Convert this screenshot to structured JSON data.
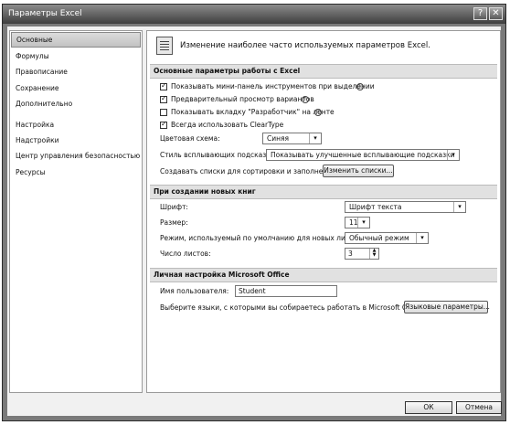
{
  "window": {
    "title": "Параметры Excel",
    "help_icon": "?",
    "close_icon": "✕"
  },
  "sidebar": {
    "items": [
      {
        "label": "Основные",
        "selected": true
      },
      {
        "label": "Формулы"
      },
      {
        "label": "Правописание"
      },
      {
        "label": "Сохранение"
      },
      {
        "label": "Дополнительно"
      },
      {
        "label": "Настройка"
      },
      {
        "label": "Надстройки"
      },
      {
        "label": "Центр управления безопасностью"
      },
      {
        "label": "Ресурсы"
      }
    ]
  },
  "header": {
    "text": "Изменение наиболее часто используемых параметров Excel."
  },
  "section1": {
    "title": "Основные параметры работы с Excel",
    "checks": [
      {
        "label": "Показывать мини-панель инструментов при выделении",
        "checked": true,
        "info": true
      },
      {
        "label": "Предварительный просмотр вариантов",
        "checked": true,
        "info": true
      },
      {
        "label": "Показывать вкладку \"Разработчик\" на ленте",
        "checked": false,
        "info": true
      },
      {
        "label": "Всегда использовать ClearType",
        "checked": true,
        "info": false
      }
    ],
    "color_scheme_label": "Цветовая схема:",
    "color_scheme_value": "Синяя",
    "tooltip_style_label": "Стиль всплывающих подсказок:",
    "tooltip_style_value": "Показывать улучшенные всплывающие подсказки",
    "lists_label": "Создавать списки для сортировки и заполнения:",
    "lists_button": "Изменить списки..."
  },
  "section2": {
    "title": "При создании новых книг",
    "font_label": "Шрифт:",
    "font_value": "Шрифт текста",
    "size_label": "Размер:",
    "size_value": "11",
    "view_label": "Режим, используемый по умолчанию для новых листов:",
    "view_value": "Обычный режим",
    "sheets_label": "Число листов:",
    "sheets_value": "3"
  },
  "section3": {
    "title": "Личная настройка Microsoft Office",
    "user_label": "Имя пользователя:",
    "user_value": "Student",
    "lang_label": "Выберите языки, с которыми вы собираетесь работать в Microsoft Office:",
    "lang_button": "Языковые параметры..."
  },
  "footer": {
    "ok": "ОК",
    "cancel": "Отмена"
  }
}
